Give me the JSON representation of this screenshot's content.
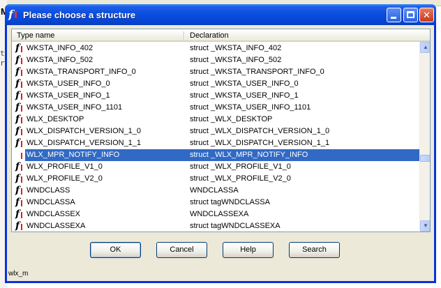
{
  "background": {
    "menu_letter": "M",
    "code_fragments": [
      "t",
      "r"
    ]
  },
  "dialog": {
    "title": "Please choose a structure",
    "title_icon": "fi-logo-icon",
    "columns": [
      "Type name",
      "Declaration"
    ],
    "rows": [
      {
        "name": "WKSTA_INFO_402",
        "decl": "struct _WKSTA_INFO_402"
      },
      {
        "name": "WKSTA_INFO_502",
        "decl": "struct _WKSTA_INFO_502"
      },
      {
        "name": "WKSTA_TRANSPORT_INFO_0",
        "decl": "struct _WKSTA_TRANSPORT_INFO_0"
      },
      {
        "name": "WKSTA_USER_INFO_0",
        "decl": "struct _WKSTA_USER_INFO_0"
      },
      {
        "name": "WKSTA_USER_INFO_1",
        "decl": "struct _WKSTA_USER_INFO_1"
      },
      {
        "name": "WKSTA_USER_INFO_1101",
        "decl": "struct _WKSTA_USER_INFO_1101"
      },
      {
        "name": "WLX_DESKTOP",
        "decl": "struct _WLX_DESKTOP"
      },
      {
        "name": "WLX_DISPATCH_VERSION_1_0",
        "decl": "struct _WLX_DISPATCH_VERSION_1_0"
      },
      {
        "name": "WLX_DISPATCH_VERSION_1_1",
        "decl": "struct _WLX_DISPATCH_VERSION_1_1"
      },
      {
        "name": "WLX_MPR_NOTIFY_INFO",
        "decl": "struct _WLX_MPR_NOTIFY_INFO",
        "selected": true
      },
      {
        "name": "WLX_PROFILE_V1_0",
        "decl": "struct _WLX_PROFILE_V1_0"
      },
      {
        "name": "WLX_PROFILE_V2_0",
        "decl": "struct _WLX_PROFILE_V2_0"
      },
      {
        "name": "WNDCLASS",
        "decl": "WNDCLASSA"
      },
      {
        "name": "WNDCLASSA",
        "decl": "struct tagWNDCLASSA"
      },
      {
        "name": "WNDCLASSEX",
        "decl": "WNDCLASSEXA"
      },
      {
        "name": "WNDCLASSEXA",
        "decl": "struct tagWNDCLASSEXA"
      }
    ],
    "buttons": {
      "ok": "OK",
      "cancel": "Cancel",
      "help": "Help",
      "search": "Search"
    },
    "status": "wlx_m",
    "selection_color": "#316ac5"
  }
}
